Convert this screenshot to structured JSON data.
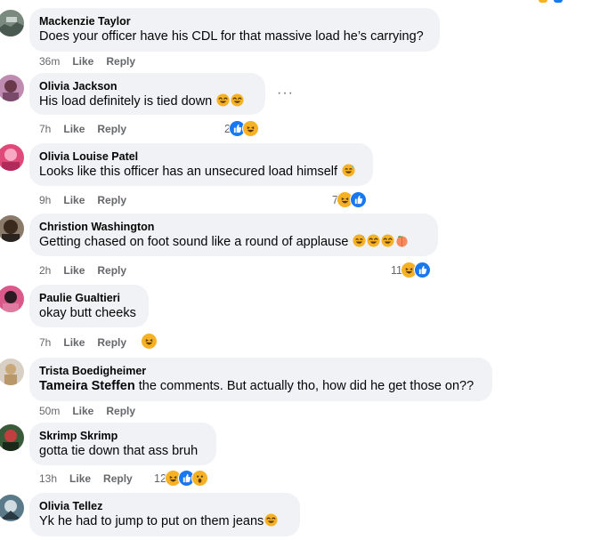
{
  "colors": {
    "bubble_bg": "#f0f2f5",
    "meta_text": "#65676b",
    "like_blue": "#1877f2",
    "emoji_yellow": "#f7b125"
  },
  "action_labels": {
    "like": "Like",
    "reply": "Reply"
  },
  "comments": [
    {
      "author": "Mackenzie Taylor",
      "text": "Does your officer have his CDL for that massive load he’s carrying?",
      "time": "36m",
      "reactions": [],
      "reaction_count": ""
    },
    {
      "author": "Olivia Jackson",
      "text": "His load definitely is tied down",
      "text_emojis": [
        "rolling-laughing",
        "rolling-laughing"
      ],
      "time": "7h",
      "reactions": [
        "like",
        "haha"
      ],
      "reaction_count": "2"
    },
    {
      "author": "Olivia Louise Patel",
      "text": "Looks like this officer has an unsecured load himself",
      "text_emojis": [
        "grinning-sweat"
      ],
      "time": "9h",
      "reactions": [
        "haha",
        "like"
      ],
      "reaction_count": "7"
    },
    {
      "author": "Christion Washington",
      "text": "Getting chased on foot sound like a round of applause",
      "text_emojis": [
        "grinning-sweat",
        "rolling-laughing",
        "rolling-laughing",
        "peach"
      ],
      "time": "2h",
      "reactions": [
        "haha",
        "like"
      ],
      "reaction_count": "11"
    },
    {
      "author": "Paulie Gualtieri",
      "text": "okay butt cheeks",
      "time": "7h",
      "reactions": [
        "haha"
      ],
      "reaction_count": ""
    },
    {
      "author": "Trista Boedigheimer",
      "mention": "Tameira Steffen",
      "text": " the comments. But actually tho, how did he get those on??",
      "time": "50m",
      "reactions": [],
      "reaction_count": ""
    },
    {
      "author": "Skrimp Skrimp",
      "text": "gotta tie down that ass bruh",
      "time": "13h",
      "reactions": [
        "haha",
        "like",
        "wow"
      ],
      "reaction_count": "12"
    },
    {
      "author": "Olivia Tellez",
      "text": "Yk he had to jump to put on them jeans",
      "text_emojis": [
        "rolling-laughing"
      ],
      "time": "",
      "reactions": [],
      "reaction_count": ""
    }
  ]
}
